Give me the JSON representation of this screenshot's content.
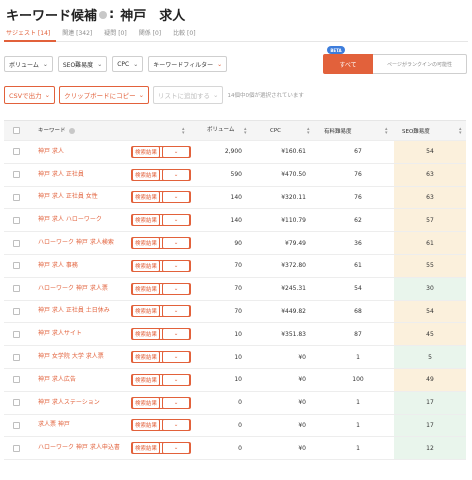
{
  "header": {
    "title_prefix": "キーワード候補",
    "separator": ":",
    "query": "神戸　求人"
  },
  "tabs": [
    {
      "label": "サジェスト [14]",
      "active": true
    },
    {
      "label": "関連 [342]",
      "active": false
    },
    {
      "label": "疑問 [0]",
      "active": false
    },
    {
      "label": "関係 [0]",
      "active": false
    },
    {
      "label": "比較 [0]",
      "active": false
    }
  ],
  "filters": {
    "volume": "ボリューム",
    "seo_difficulty": "SEO難易度",
    "cpc": "CPC",
    "keyword_filter": "キーワードフィルター"
  },
  "segment": {
    "beta": "BETA",
    "all": "すべて",
    "ranking_potential": "ページがランクインの可能性"
  },
  "actions": {
    "csv_export": "CSVで出力",
    "copy_clipboard": "クリップボードにコピー",
    "add_to_list": "リストに追加する",
    "selection_note": "14個中0個が選択されています"
  },
  "table": {
    "columns": {
      "keyword": "キーワード",
      "volume": "ボリューム",
      "cpc": "CPC",
      "paid_difficulty": "有料難易度",
      "seo_difficulty": "SEO難易度"
    },
    "search_results_label": "検索結果",
    "rows": [
      {
        "keyword": "神戸 求人",
        "volume": "2,900",
        "cpc": "¥160.61",
        "paid": "67",
        "seo": "54",
        "seo_color": "#fbf0dc"
      },
      {
        "keyword": "神戸 求人 正社員",
        "volume": "590",
        "cpc": "¥470.50",
        "paid": "76",
        "seo": "63",
        "seo_color": "#fbf0dc"
      },
      {
        "keyword": "神戸 求人 正社員 女性",
        "volume": "140",
        "cpc": "¥320.11",
        "paid": "76",
        "seo": "63",
        "seo_color": "#fbf0dc"
      },
      {
        "keyword": "神戸 求人 ハローワーク",
        "volume": "140",
        "cpc": "¥110.79",
        "paid": "62",
        "seo": "57",
        "seo_color": "#fbf0dc"
      },
      {
        "keyword": "ハローワーク 神戸 求人検索",
        "volume": "90",
        "cpc": "¥79.49",
        "paid": "36",
        "seo": "61",
        "seo_color": "#fbf0dc"
      },
      {
        "keyword": "神戸 求人 事務",
        "volume": "70",
        "cpc": "¥372.80",
        "paid": "61",
        "seo": "55",
        "seo_color": "#fbf0dc"
      },
      {
        "keyword": "ハローワーク 神戸 求人票",
        "volume": "70",
        "cpc": "¥245.31",
        "paid": "54",
        "seo": "30",
        "seo_color": "#e9f5ec"
      },
      {
        "keyword": "神戸 求人 正社員 土日休み",
        "volume": "70",
        "cpc": "¥449.82",
        "paid": "68",
        "seo": "54",
        "seo_color": "#fbf0dc"
      },
      {
        "keyword": "神戸 求人サイト",
        "volume": "10",
        "cpc": "¥351.83",
        "paid": "87",
        "seo": "45",
        "seo_color": "#fbf0dc"
      },
      {
        "keyword": "神戸 女学院 大学 求人票",
        "volume": "10",
        "cpc": "¥0",
        "paid": "1",
        "seo": "5",
        "seo_color": "#e9f5ec"
      },
      {
        "keyword": "神戸 求人広告",
        "volume": "10",
        "cpc": "¥0",
        "paid": "100",
        "seo": "49",
        "seo_color": "#fbf0dc"
      },
      {
        "keyword": "神戸 求人ステーション",
        "volume": "0",
        "cpc": "¥0",
        "paid": "1",
        "seo": "17",
        "seo_color": "#e9f5ec"
      },
      {
        "keyword": "求人票 神戸",
        "volume": "0",
        "cpc": "¥0",
        "paid": "1",
        "seo": "17",
        "seo_color": "#e9f5ec"
      },
      {
        "keyword": "ハローワーク 神戸 求人申込書",
        "volume": "0",
        "cpc": "¥0",
        "paid": "1",
        "seo": "12",
        "seo_color": "#e9f5ec"
      }
    ]
  }
}
